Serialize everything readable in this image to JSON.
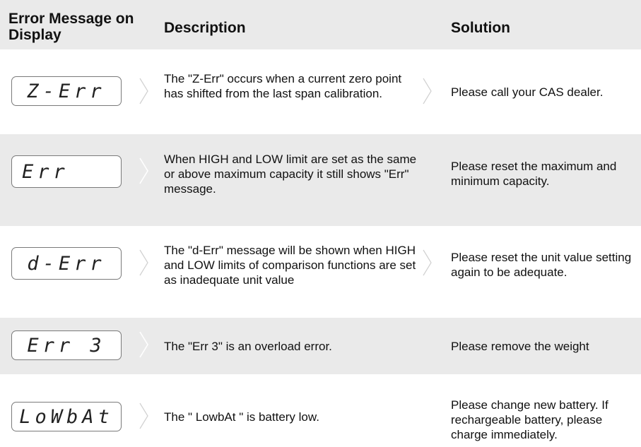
{
  "header": {
    "col1": "Error Message on Display",
    "col2": "Description",
    "col3": "Solution"
  },
  "rows": [
    {
      "display": "Z-Err",
      "description": "The \"Z-Err\" occurs when a current zero point has shifted from the last span calibration.",
      "solution": "Please call your CAS dealer."
    },
    {
      "display": "Err",
      "description": "When HIGH and LOW limit are set as the same or above maximum capacity it still shows \"Err\" message.",
      "solution": "Please reset the maximum and minimum capacity."
    },
    {
      "display": "d-Err",
      "description": "The \"d-Err\" message will be shown when HIGH and LOW limits of comparison functions are set as inadequate unit value",
      "solution": "Please reset the unit value setting again to be adequate."
    },
    {
      "display": "Err 3",
      "description": "The \"Err 3\" is an overload error.",
      "solution": "Please remove the weight"
    },
    {
      "display": "LoWbAt",
      "description": "The \" LowbAt \" is battery low.",
      "solution": "Please change new battery. If rechargeable battery, please charge immediately."
    }
  ],
  "colors": {
    "row_shade": "#eaeaea",
    "chevron": "#bdbdbd"
  }
}
